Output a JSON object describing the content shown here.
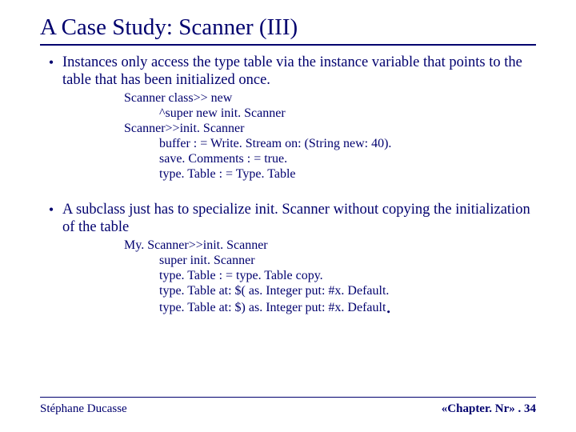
{
  "title": "A Case Study: Scanner (III)",
  "bullets": [
    {
      "text": "Instances only access the type table via the instance variable that points to the table that has been initialized once.",
      "code": [
        "Scanner class>> new",
        "           ^super new init. Scanner",
        "Scanner>>init. Scanner",
        "           buffer : = Write. Stream on: (String new: 40).",
        "           save. Comments : = true.",
        "           type. Table : = Type. Table"
      ]
    },
    {
      "text": "A subclass just has to specialize init. Scanner without copying the initialization of the table",
      "code": [
        "My. Scanner>>init. Scanner",
        "           super init. Scanner",
        "           type. Table : = type. Table copy.",
        "           type. Table at: $( as. Integer put: #x. Default.",
        "           type. Table at: $) as. Integer put: #x. Default"
      ],
      "trailing_big_dot": "."
    }
  ],
  "footer": {
    "left": "Stéphane Ducasse",
    "right": " «Chapter. Nr» . 34"
  }
}
